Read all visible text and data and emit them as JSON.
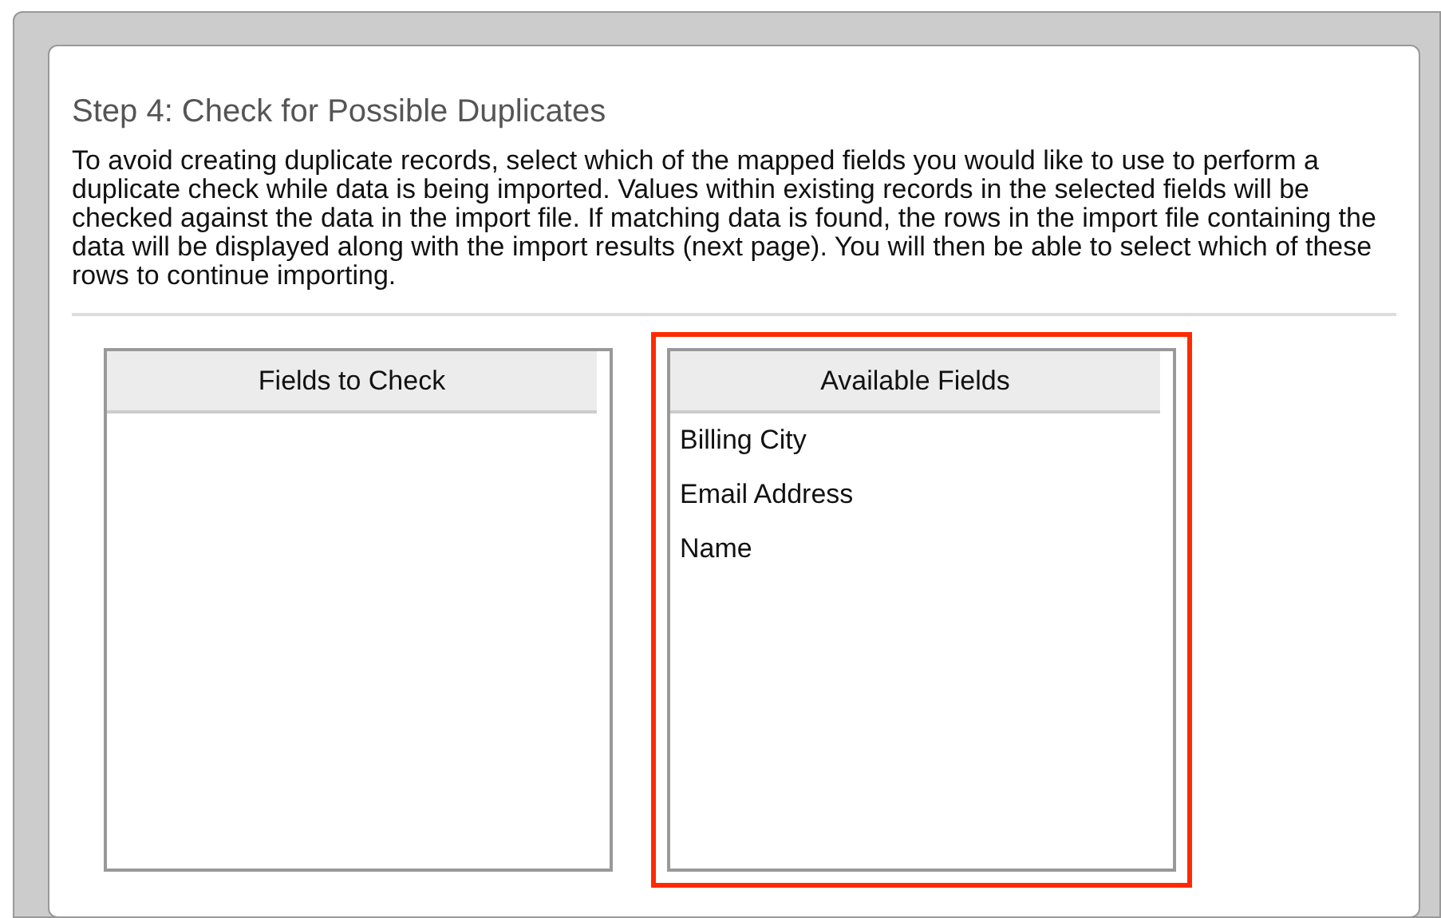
{
  "step_title": "Step 4: Check for Possible Duplicates",
  "description": "To avoid creating duplicate records, select which of the mapped fields you would like to use to perform a duplicate check while data is being imported. Values within existing records in the selected fields will be checked against the data in the import file. If matching data is found, the rows in the import file containing the data will be displayed along with the import results (next page). You will then be able to select which of these rows to continue importing.",
  "lists": [
    {
      "title": "Fields to Check",
      "highlighted": false
    },
    {
      "title": "Available Fields",
      "highlighted": true,
      "items": [
        "Billing City",
        "Email Address",
        "Name"
      ]
    }
  ]
}
